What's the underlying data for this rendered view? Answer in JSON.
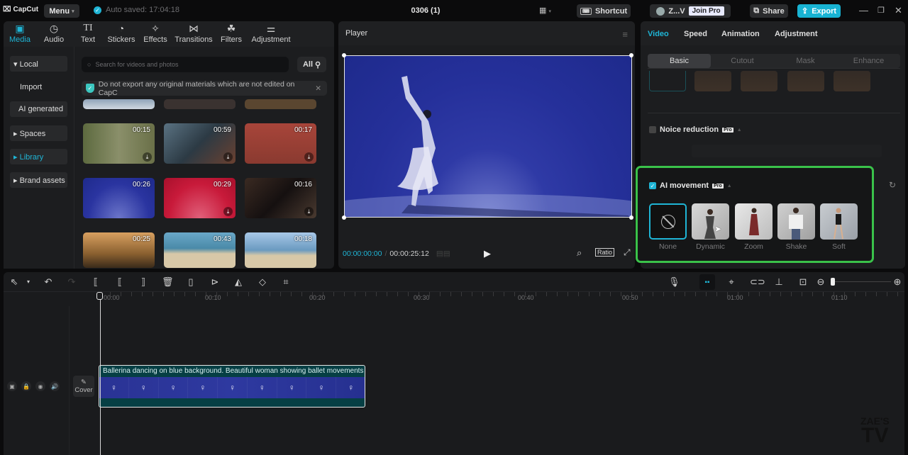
{
  "titlebar": {
    "app_name": "CapCut",
    "menu_label": "Menu",
    "autosave": "Auto saved: 17:04:18",
    "project_title": "0306 (1)",
    "shortcut_label": "Shortcut",
    "user_label": "Z...V",
    "join_pro_label": "Join Pro",
    "share_label": "Share",
    "export_label": "Export"
  },
  "media_tabs": [
    {
      "label": "Media",
      "icon": "media-icon",
      "active": true
    },
    {
      "label": "Audio",
      "icon": "audio-icon"
    },
    {
      "label": "Text",
      "icon": "text-icon"
    },
    {
      "label": "Stickers",
      "icon": "stickers-icon"
    },
    {
      "label": "Effects",
      "icon": "effects-icon"
    },
    {
      "label": "Transitions",
      "icon": "transitions-icon"
    },
    {
      "label": "Filters",
      "icon": "filters-icon"
    },
    {
      "label": "Adjustment",
      "icon": "adjustment-icon"
    }
  ],
  "sidebar": {
    "items": [
      {
        "label": "▾ Local"
      },
      {
        "label": "Import"
      },
      {
        "label": "AI generated"
      },
      {
        "label": "▸ Spaces"
      },
      {
        "label": "▸ Library",
        "active": true
      },
      {
        "label": "▸ Brand assets"
      }
    ]
  },
  "library": {
    "search_placeholder": "Search for videos and photos",
    "filter_label": "All",
    "notice": "Do not export any original materials which are not edited on CapC",
    "thumbnails": [
      {
        "duration": "00:15",
        "desc": "woman in forest"
      },
      {
        "duration": "00:59",
        "desc": "waves on rocks"
      },
      {
        "duration": "00:17",
        "desc": "red brick wall"
      },
      {
        "duration": "00:26",
        "desc": "ballerina blue background"
      },
      {
        "duration": "00:29",
        "desc": "ballerina red background"
      },
      {
        "duration": "00:16",
        "desc": "piano playing"
      },
      {
        "duration": "00:25",
        "desc": "kids at sunset"
      },
      {
        "duration": "00:43",
        "desc": "couple on beach"
      },
      {
        "duration": "00:18",
        "desc": "person on beach"
      }
    ]
  },
  "player": {
    "title": "Player",
    "current_time": "00:00:00:00",
    "total_time": "00:00:25:12",
    "ratio_label": "Ratio"
  },
  "inspector": {
    "tabs": [
      {
        "label": "Video",
        "active": true
      },
      {
        "label": "Speed"
      },
      {
        "label": "Animation"
      },
      {
        "label": "Adjustment"
      }
    ],
    "subtabs": [
      {
        "label": "Basic",
        "active": true
      },
      {
        "label": "Cutout"
      },
      {
        "label": "Mask"
      },
      {
        "label": "Enhance"
      }
    ],
    "noise_reduction": {
      "label": "Noice reduction",
      "badge": "Pro",
      "checked": false
    },
    "ai_movement": {
      "label": "AI movement",
      "badge": "Pro",
      "checked": true,
      "options": [
        {
          "label": "None",
          "selected": true
        },
        {
          "label": "Dynamic"
        },
        {
          "label": "Zoom"
        },
        {
          "label": "Shake"
        },
        {
          "label": "Soft"
        }
      ]
    }
  },
  "timeline": {
    "ruler": [
      "00:00",
      "00:10",
      "00:20",
      "00:30",
      "00:40",
      "00:50",
      "01:00",
      "01:10"
    ],
    "clip_title": "Ballerina dancing on blue background. Beautiful woman showing ballet movements",
    "cover_label": "Cover"
  },
  "watermark": {
    "line1": "ZAE'S",
    "line2": "TV"
  },
  "colors": {
    "accent": "#1fb5d6",
    "highlight_box": "#3ac24a",
    "clip_bg": "#063f44"
  }
}
